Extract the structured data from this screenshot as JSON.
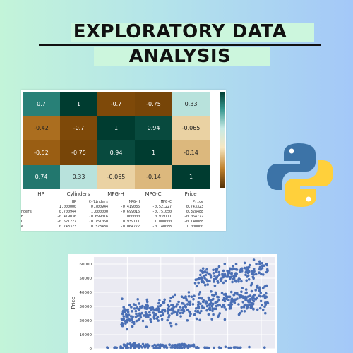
{
  "title": {
    "line1": "EXPLORATORY DATA",
    "line2": "ANALYSIS"
  },
  "colors": {
    "background_left": "#c3f4d9",
    "background_right": "#a4c8f8",
    "python_blue": "#3c73a7",
    "python_yellow": "#ffd03b",
    "scatter_point": "#4a6fb5",
    "highlight": "#ccf6dd"
  },
  "icons": [
    "python-logo-icon"
  ],
  "heatmap": {
    "labels": [
      "HP",
      "Cylinders",
      "MPG-H",
      "MPG-C",
      "Price"
    ],
    "values": [
      [
        1,
        0.7,
        -0.7,
        -0.75,
        0.33
      ],
      [
        0.7,
        1,
        -0.7,
        -0.75,
        0.33
      ],
      [
        -0.42,
        -0.7,
        1,
        0.94,
        -0.065
      ],
      [
        -0.52,
        -0.75,
        0.94,
        1,
        -0.14
      ],
      [
        0.74,
        0.33,
        -0.065,
        -0.14,
        1
      ]
    ],
    "display": [
      [
        "0.7",
        "1",
        "-0.7",
        "-0.75",
        "0.33"
      ],
      [
        "-0.42",
        "-0.7",
        "1",
        "0.94",
        "-0.065"
      ],
      [
        "-0.52",
        "-0.75",
        "0.94",
        "1",
        "-0.14"
      ],
      [
        "0.74",
        "0.33",
        "-0.065",
        "-0.14",
        "1"
      ]
    ],
    "colorscale": "BrBG"
  },
  "corr_table": {
    "columns": [
      "HP",
      "Cylinders",
      "MPG-H",
      "MPG-C",
      "Price"
    ],
    "rows": [
      {
        "index": "",
        "values": [
          "1.000000",
          "0.700944",
          "-0.419036",
          "-0.521227",
          "0.743323"
        ]
      },
      {
        "index": "nders",
        "values": [
          "0.700944",
          "1.000000",
          "-0.699016",
          "-0.751050",
          "0.328488"
        ]
      },
      {
        "index": "H",
        "values": [
          "-0.419036",
          "-0.699016",
          "1.000000",
          "0.939111",
          "-0.064772"
        ]
      },
      {
        "index": "C",
        "values": [
          "-0.521227",
          "-0.751050",
          "0.939111",
          "1.000000",
          "-0.140088"
        ]
      },
      {
        "index": "e",
        "values": [
          "0.743323",
          "0.328488",
          "-0.064772",
          "-0.140088",
          "1.000000"
        ]
      }
    ]
  },
  "chart_data": {
    "type": "scatter",
    "ylabel": "Price",
    "xlabel": "",
    "y_ticks": [
      "0",
      "10000",
      "20000",
      "30000",
      "40000",
      "50000",
      "60000"
    ],
    "ylim": [
      0,
      65000
    ],
    "grid": true,
    "clusters": [
      {
        "x_range": [
          30,
          520
        ],
        "y_center": 800,
        "y_spread": 600,
        "count": 60
      },
      {
        "x_range": [
          80,
          300
        ],
        "y_center": 2500,
        "y_spread": 1500,
        "count": 90
      },
      {
        "x_range": [
          80,
          520
        ],
        "y_center": 28000,
        "y_spread": 14000,
        "count": 420
      },
      {
        "x_range": [
          300,
          520
        ],
        "y_center": 48000,
        "y_spread": 10000,
        "count": 160
      }
    ]
  }
}
